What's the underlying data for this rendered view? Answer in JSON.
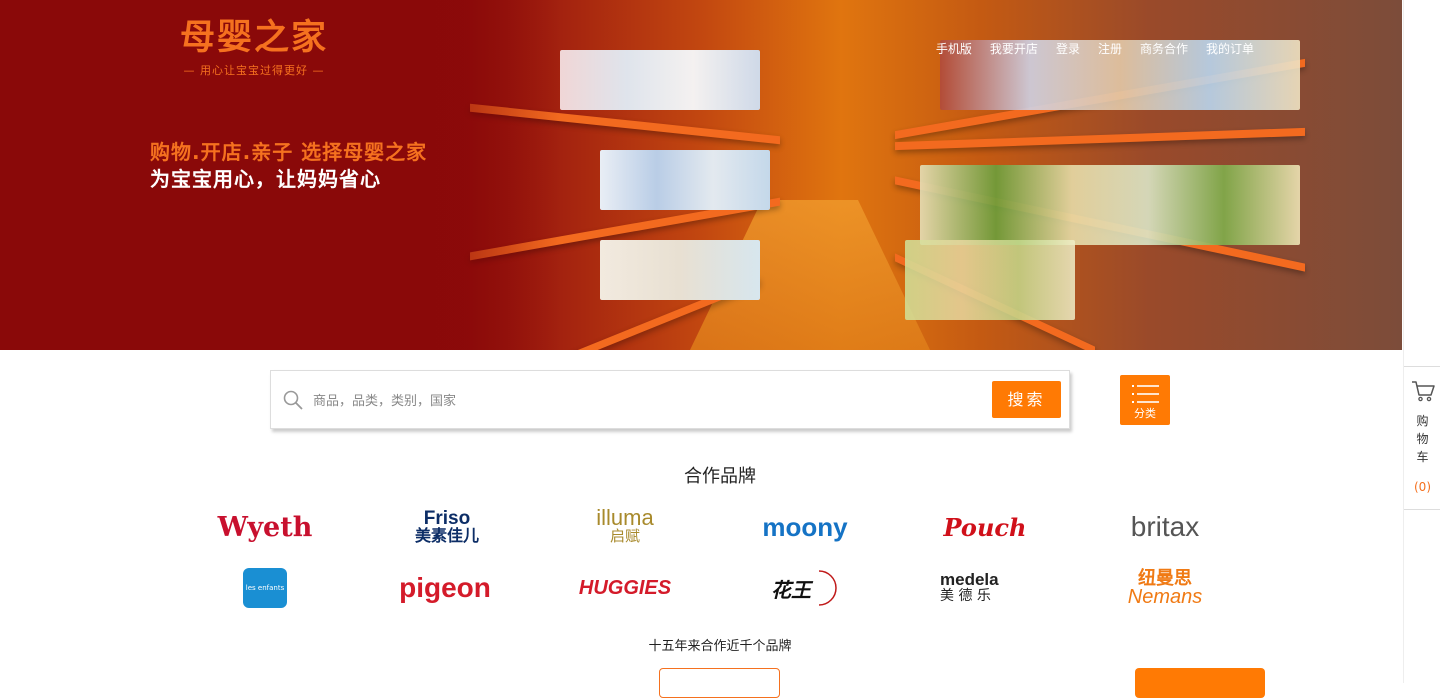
{
  "header": {
    "logo_name": "母婴之家",
    "logo_slogan": "— 用心让宝宝过得更好 —",
    "nav": [
      "手机版",
      "我要开店",
      "登录",
      "注册",
      "商务合作",
      "我的订单"
    ],
    "tagline_1": "购物.开店.亲子 选择母婴之家",
    "tagline_2": "为宝宝用心，让妈妈省心"
  },
  "search": {
    "placeholder": "商品，品类，类别，国家",
    "button_label": "搜索",
    "category_label": "分类"
  },
  "brands": {
    "title": "合作品牌",
    "items": [
      "Wyeth",
      "Friso",
      "美素佳儿",
      "illuma",
      "启赋",
      "moony",
      "Pouch",
      "britax",
      "les enfants",
      "pigeon",
      "HUGGIES",
      "花王",
      "medela",
      "美 德 乐",
      "纽曼思",
      "Nemans"
    ],
    "subtitle": "十五年来合作近千个品牌"
  },
  "cart": {
    "label": "购物车",
    "count": "(0)"
  },
  "colors": {
    "accent": "#ff7a04",
    "hero_dark": "#8c0a0a"
  }
}
